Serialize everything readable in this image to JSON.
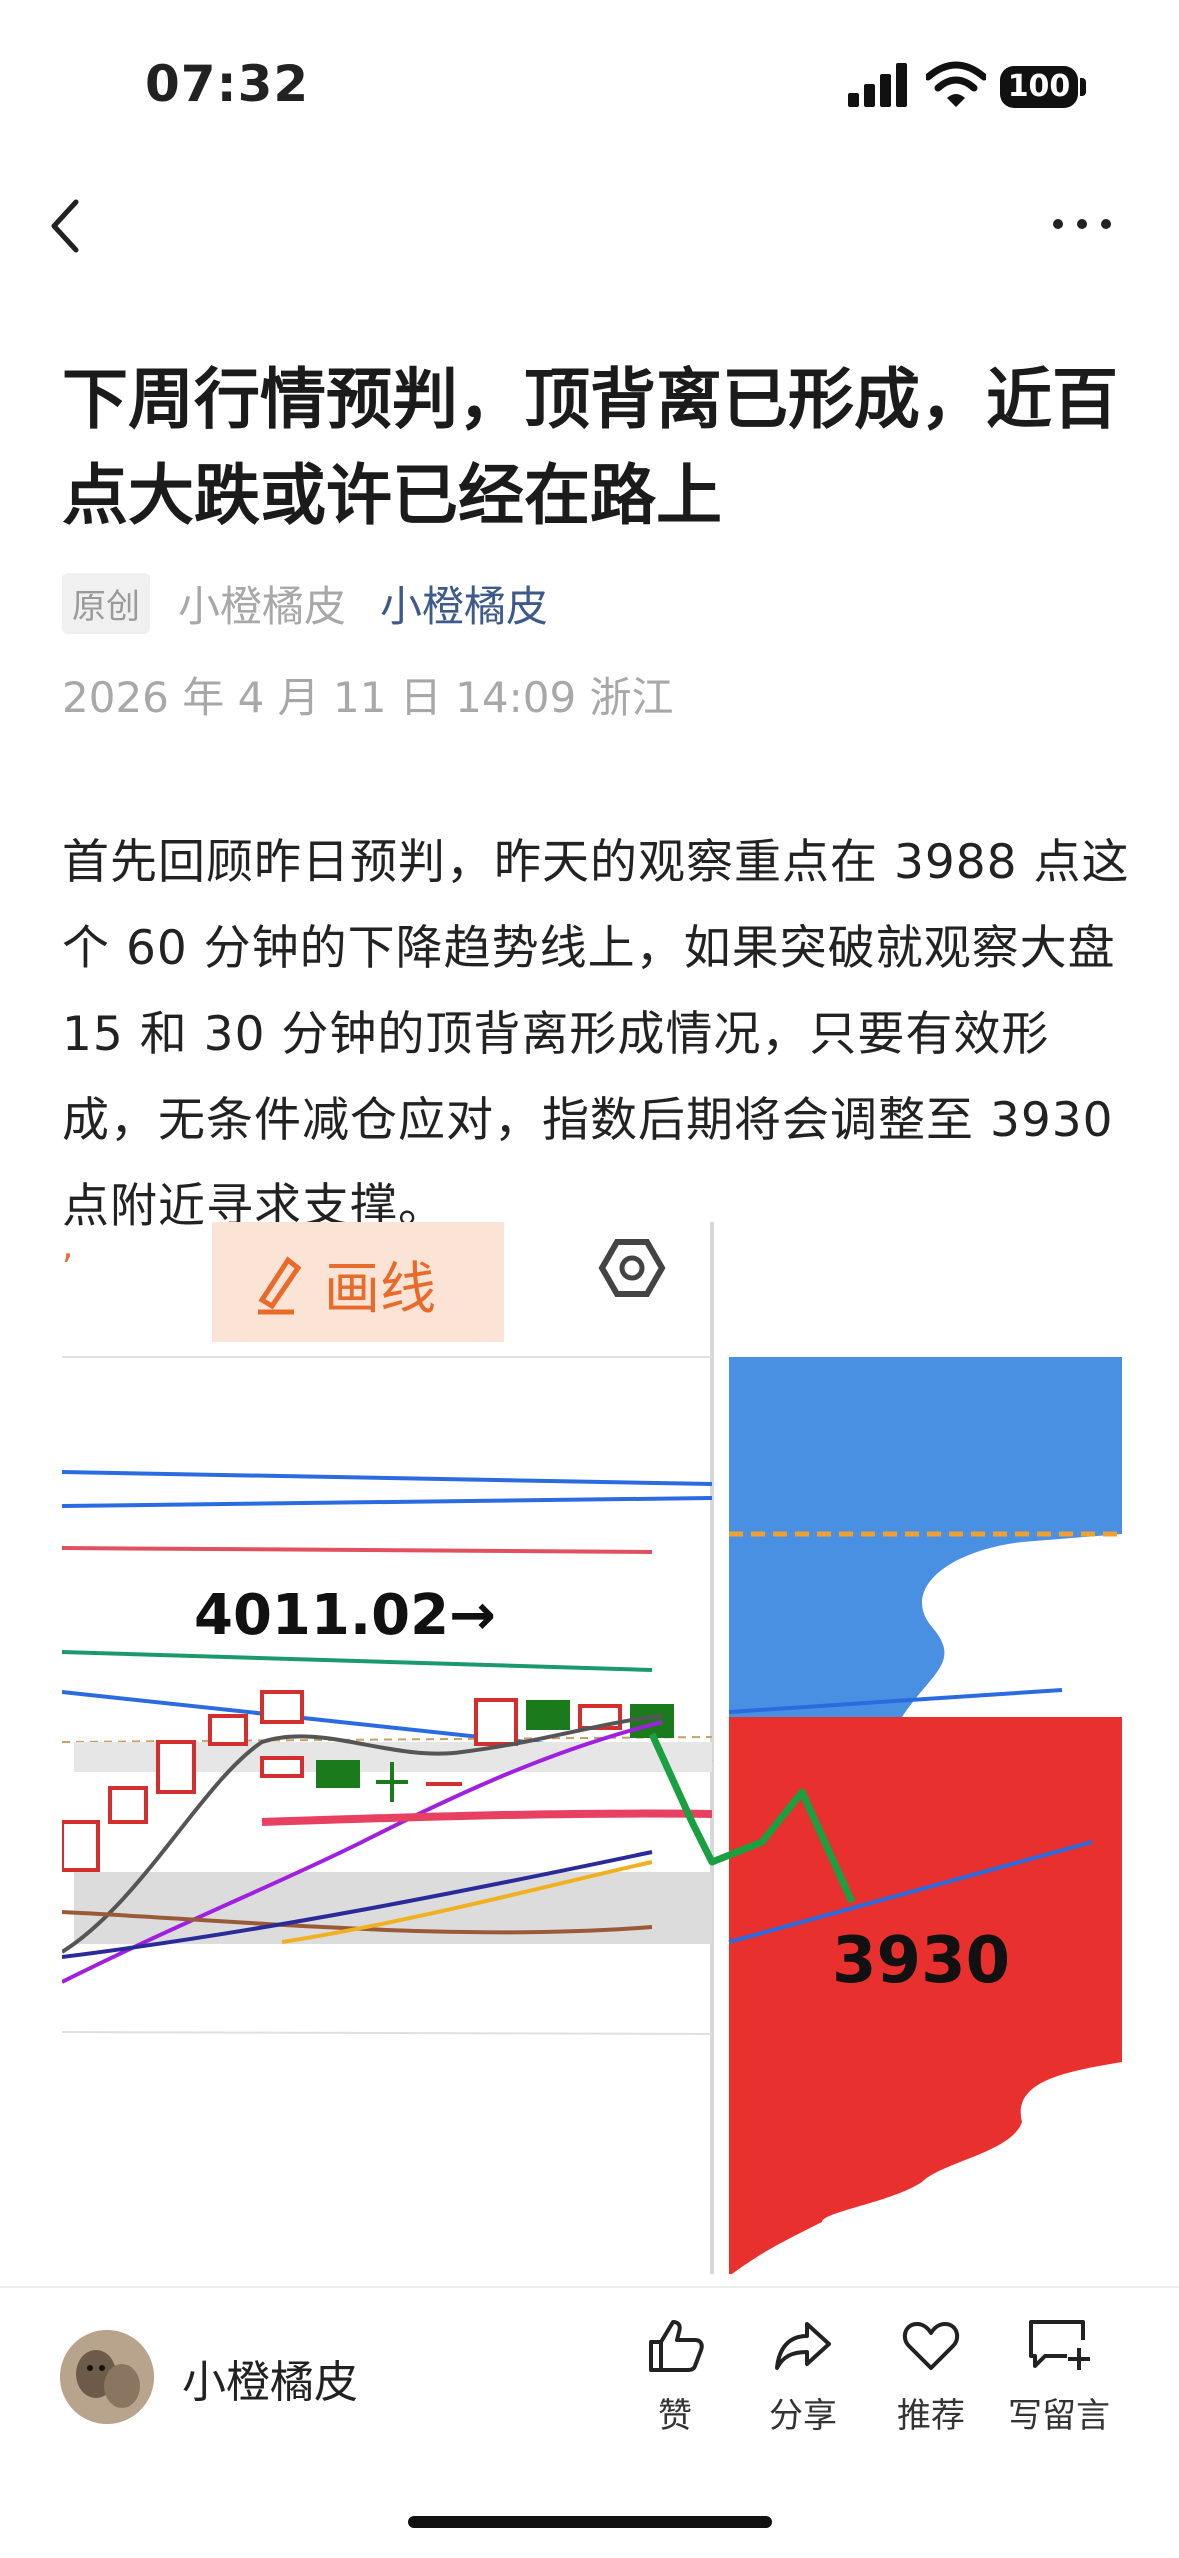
{
  "status_bar": {
    "time": "07:32",
    "battery": "100"
  },
  "article": {
    "title": "下周行情预判，顶背离已形成，近百点大跌或许已经在路上",
    "tag": "原创",
    "source_name": "小橙橘皮",
    "author_link": "小橙橘皮",
    "date_location": "2026 年 4 月 11 日  14:09   浙江",
    "paragraph": "首先回顾昨日预判，昨天的观察重点在 3988 点这个 60 分钟的下降趋势线上，如果突破就观察大盘 15 和 30 分钟的顶背离形成情况，只要有效形成，无条件减仓应对，指数后期将会调整至 3930 点附近寻求支撑。"
  },
  "chart_image": {
    "draw_button": "画线",
    "price_label": "4011.02→",
    "support_label": "3930"
  },
  "bottom_bar": {
    "username": "小橙橘皮",
    "like_label": "赞",
    "share_label": "分享",
    "recommend_label": "推荐",
    "comment_label": "写留言"
  },
  "colors": {
    "link": "#3d5a8a",
    "muted": "#a8a8a8",
    "up_candle": "#d32f2f",
    "down_candle": "#1b7a1b",
    "volume_red": "#e8302e",
    "volume_blue": "#4a90e2"
  }
}
